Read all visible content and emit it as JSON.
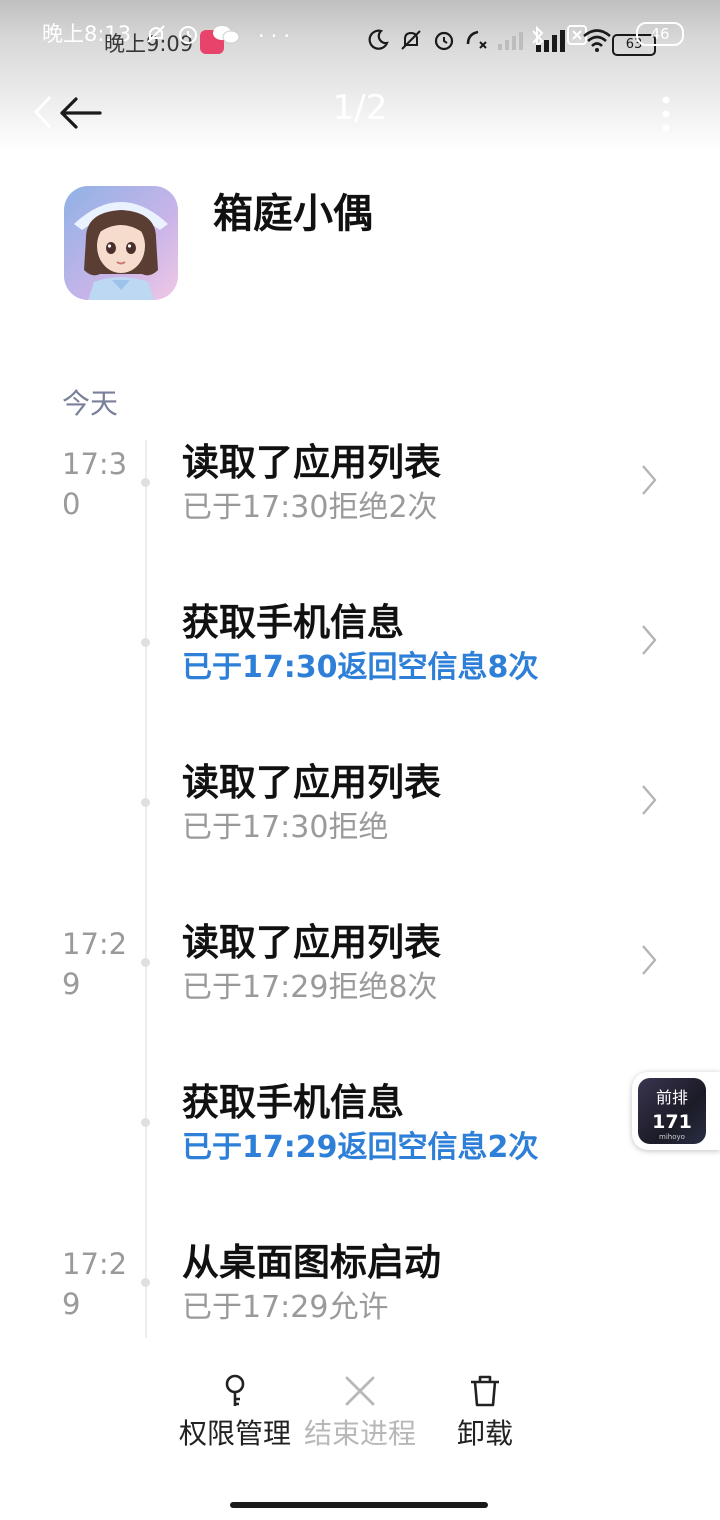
{
  "status_bar": {
    "time": "晚上8:13",
    "time_ghost": "晚上9:09",
    "dots": "···",
    "battery": "46",
    "battery_ghost": "63"
  },
  "nav": {
    "page_counter": "1/2"
  },
  "app": {
    "name": "箱庭小偶"
  },
  "date_group": "今天",
  "entries": [
    {
      "time": "17:30",
      "title": "读取了应用列表",
      "detail": "已于17:30拒绝2次",
      "highlight": false,
      "has_chevron": true
    },
    {
      "time": "",
      "title": "获取手机信息",
      "detail": "已于17:30返回空信息8次",
      "highlight": true,
      "has_chevron": true
    },
    {
      "time": "",
      "title": "读取了应用列表",
      "detail": "已于17:30拒绝",
      "highlight": false,
      "has_chevron": true
    },
    {
      "time": "17:29",
      "title": "读取了应用列表",
      "detail": "已于17:29拒绝8次",
      "highlight": false,
      "has_chevron": true
    },
    {
      "time": "",
      "title": "获取手机信息",
      "detail": "已于17:29返回空信息2次",
      "highlight": true,
      "has_chevron": false
    },
    {
      "time": "17:29",
      "title": "从桌面图标启动",
      "detail": "已于17:29允许",
      "highlight": false,
      "has_chevron": false
    }
  ],
  "floating_widget": {
    "line1": "前排",
    "line2": "171",
    "line3": "mihoyo"
  },
  "bottom_actions": {
    "permissions": "权限管理",
    "end_process": "结束进程",
    "uninstall": "卸载"
  },
  "colors": {
    "accent_blue": "#2e7fd8",
    "muted_gray": "#9a9a9a",
    "date_label": "#7a8099"
  }
}
